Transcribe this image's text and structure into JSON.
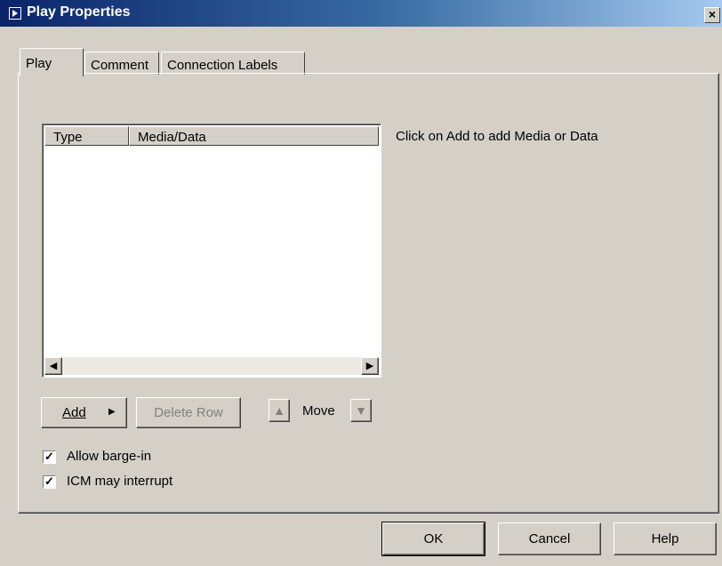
{
  "window": {
    "title": "Play Properties",
    "close_label": "×"
  },
  "tabs": [
    {
      "label": "Play"
    },
    {
      "label": "Comment"
    },
    {
      "label": "Connection Labels"
    }
  ],
  "table": {
    "columns": [
      "Type",
      "Media/Data"
    ],
    "rows": []
  },
  "hint_text": "Click on Add to add Media or Data",
  "buttons": {
    "add": "Add",
    "delete_row": "Delete Row",
    "move": "Move",
    "ok": "OK",
    "cancel": "Cancel",
    "help": "Help"
  },
  "checkboxes": [
    {
      "label": "Allow barge-in",
      "checked": true
    },
    {
      "label": "ICM may interrupt",
      "checked": true
    }
  ],
  "icons": {
    "move_up": "▲",
    "move_down": "▼",
    "scroll_left": "◀",
    "scroll_right": "▶",
    "add_menu_arrow": "▶",
    "check": "✓"
  }
}
